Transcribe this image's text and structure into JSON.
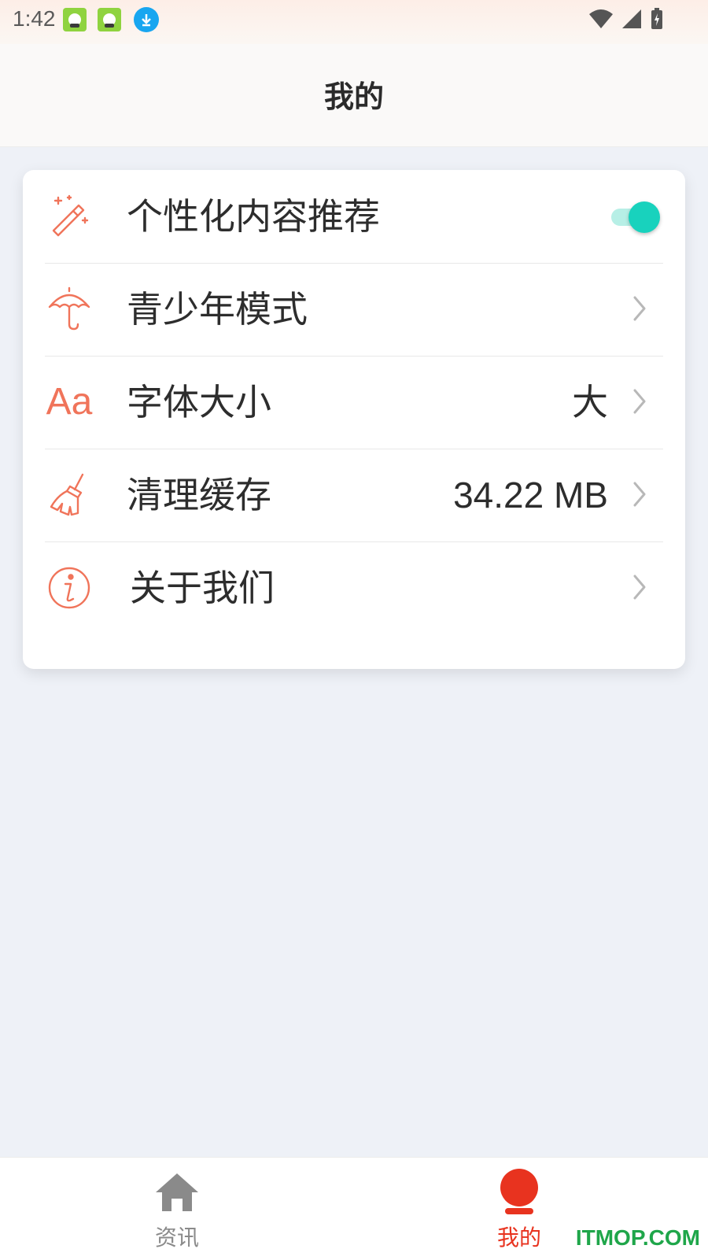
{
  "status_bar": {
    "time": "1:42"
  },
  "header": {
    "title": "我的"
  },
  "settings": {
    "items": [
      {
        "label": "个性化内容推荐",
        "icon": "magic-wand-icon",
        "type": "toggle",
        "enabled": true
      },
      {
        "label": "青少年模式",
        "icon": "umbrella-icon",
        "type": "link"
      },
      {
        "label": "字体大小",
        "icon": "font-size-icon",
        "icon_text": "Aa",
        "type": "link",
        "value": "大"
      },
      {
        "label": "清理缓存",
        "icon": "broom-icon",
        "type": "link",
        "value": "34.22 MB"
      },
      {
        "label": "关于我们",
        "icon": "info-icon",
        "type": "link"
      }
    ]
  },
  "bottom_nav": {
    "items": [
      {
        "label": "资讯",
        "icon": "home-icon",
        "active": false
      },
      {
        "label": "我的",
        "icon": "profile-icon",
        "active": true
      }
    ]
  },
  "watermark": "ITMOP.COM",
  "colors": {
    "accent": "#f0745a",
    "active_tab": "#e8331f",
    "inactive_tab": "#8a8a8a",
    "toggle_on": "#18d2bd",
    "background": "#eef1f7"
  }
}
